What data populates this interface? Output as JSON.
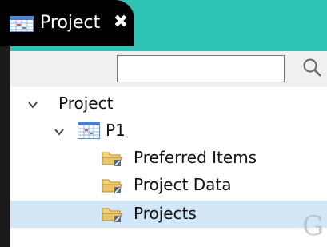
{
  "tab": {
    "title": "Project",
    "close_glyph": "✖"
  },
  "search": {
    "value": "",
    "placeholder": ""
  },
  "tree": {
    "root_label": "Project",
    "project_label": "P1",
    "children": [
      {
        "label": "Preferred Items",
        "icon": "folder-icon"
      },
      {
        "label": "Project Data",
        "icon": "folder-icon"
      },
      {
        "label": "Projects",
        "icon": "folder-icon",
        "selected": true
      }
    ]
  },
  "colors": {
    "tab_background": "#000000",
    "accent_strip": "#2fc3b5",
    "selection": "#d3e6f7",
    "folder": "#e8c46a"
  }
}
